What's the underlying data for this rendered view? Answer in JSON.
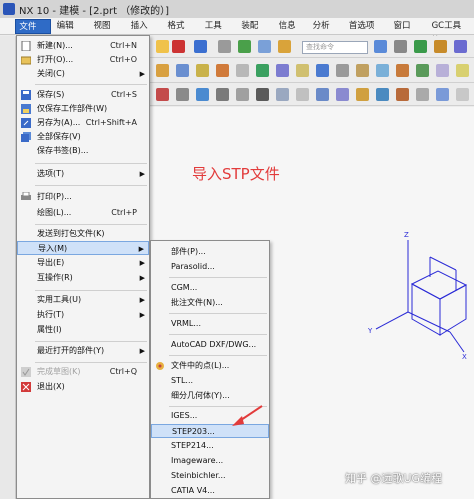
{
  "window": {
    "title": "NX 10 - 建模 - [2.prt （修改的）]"
  },
  "menubar": [
    "文件(F)",
    "编辑(E)",
    "视图(V)",
    "插入(S)",
    "格式(R)",
    "工具(T)",
    "装配(A)",
    "信息(I)",
    "分析(L)",
    "首选项(P)",
    "窗口(O)",
    "GC工具箱"
  ],
  "toolbar": {
    "search_placeholder": "查找命令"
  },
  "file_menu": [
    {
      "label": "新建(N)...",
      "shortcut": "Ctrl+N"
    },
    {
      "label": "打开(O)...",
      "shortcut": "Ctrl+O"
    },
    {
      "label": "关闭(C)",
      "submenu": true
    },
    {
      "label": "保存(S)",
      "shortcut": "Ctrl+S"
    },
    {
      "label": "仅保存工作部件(W)"
    },
    {
      "label": "另存为(A)...",
      "shortcut": "Ctrl+Shift+A"
    },
    {
      "label": "全部保存(V)"
    },
    {
      "label": "保存书签(B)..."
    },
    {
      "label": "选项(T)",
      "submenu": true
    },
    {
      "label": "打印(P)..."
    },
    {
      "label": "绘图(L)...",
      "shortcut": "Ctrl+P"
    },
    {
      "label": "发送到打包文件(K)"
    },
    {
      "label": "导入(M)",
      "submenu": true
    },
    {
      "label": "导出(E)",
      "submenu": true
    },
    {
      "label": "互操作(R)",
      "submenu": true
    },
    {
      "label": "实用工具(U)",
      "submenu": true
    },
    {
      "label": "执行(T)",
      "submenu": true
    },
    {
      "label": "属性(I)"
    },
    {
      "label": "最近打开的部件(Y)",
      "submenu": true
    },
    {
      "label": "完成草图(K)",
      "shortcut": "Ctrl+Q"
    },
    {
      "label": "退出(X)"
    }
  ],
  "import_menu": [
    "部件(P)...",
    "Parasolid...",
    "CGM...",
    "批注文件(N)...",
    "VRML...",
    "AutoCAD DXF/DWG...",
    "文件中的点(L)...",
    "STL...",
    "细分几何体(Y)...",
    "IGES...",
    "STEP203...",
    "STEP214...",
    "Imageware...",
    "Steinbichler...",
    "CATIA V4..."
  ],
  "annotation": "导入STP文件",
  "watermark": "知乎 @远歌UG编程",
  "colors": {
    "accent": "#2f6bc6",
    "highlight": "#cfe1f8",
    "annotation": "#e23b3b"
  }
}
